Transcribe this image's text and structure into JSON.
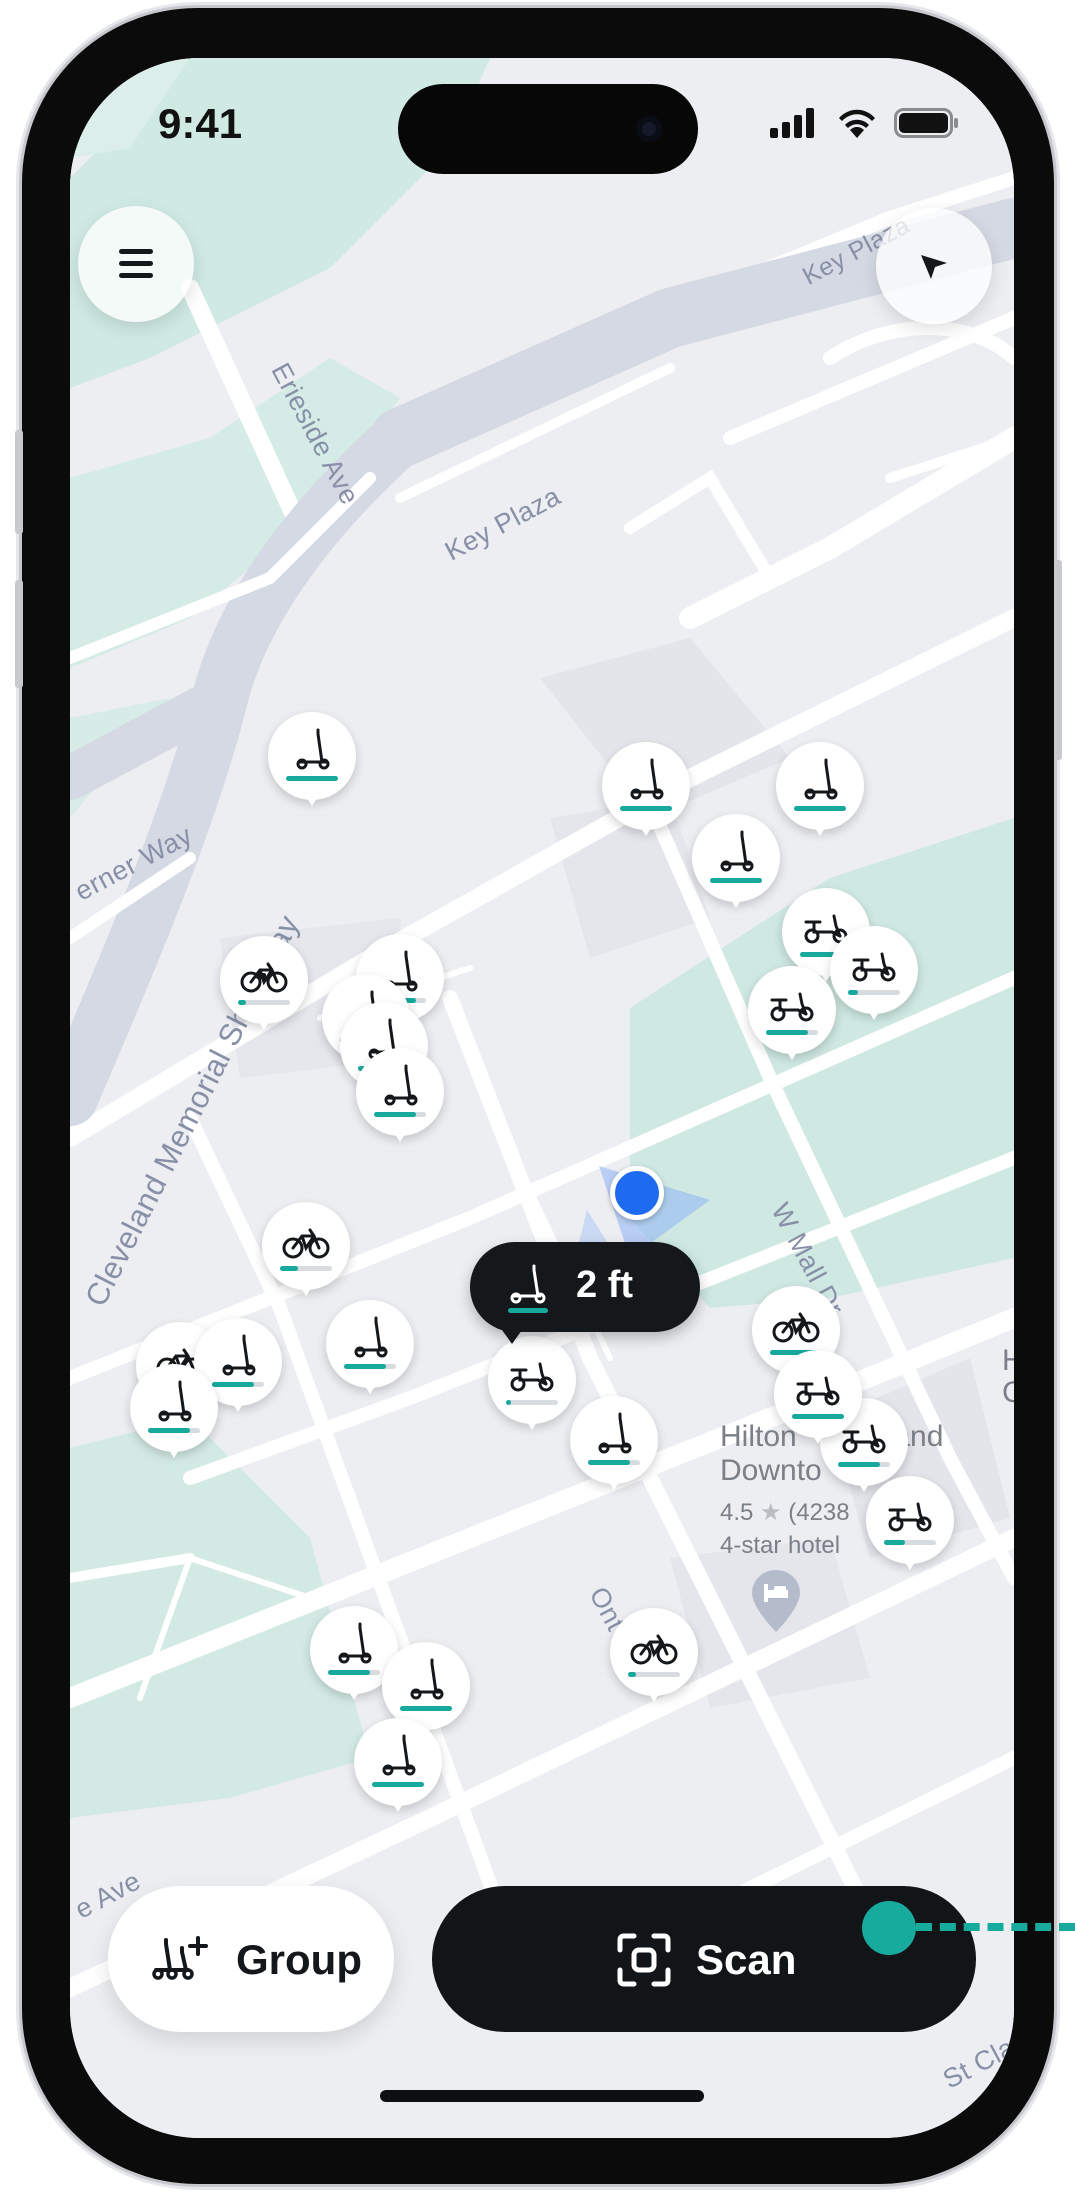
{
  "status_bar": {
    "time": "9:41"
  },
  "header": {
    "menu_icon": "hamburger-icon",
    "locate_icon": "navigation-arrow-icon"
  },
  "map": {
    "streets": [
      {
        "name": "Key Plaza"
      },
      {
        "name": "Key Plaza"
      },
      {
        "name": "Erieside Ave"
      },
      {
        "name": "Cleveland Memorial Shoreway"
      },
      {
        "name": "erner Way"
      },
      {
        "name": "W Mall Dr"
      },
      {
        "name": "Ont St"
      },
      {
        "name": "e Ave"
      },
      {
        "name": "St Cla"
      }
    ],
    "poi": {
      "name_line1": "Hilton",
      "name_line1b": "land",
      "name_line2": "Downto",
      "rating": "4.5",
      "reviews": "(4238",
      "category": "4-star hotel",
      "icon": "bed-icon"
    },
    "edge_letters": [
      "H",
      "C"
    ]
  },
  "vehicles": [
    {
      "type": "scooter",
      "battery": 1.0
    },
    {
      "type": "scooter",
      "battery": 1.0
    },
    {
      "type": "scooter",
      "battery": 1.0
    },
    {
      "type": "ebike",
      "battery": 0.15
    },
    {
      "type": "scooter",
      "battery": 1.0
    },
    {
      "type": "moped",
      "battery": 0.8
    },
    {
      "type": "moped",
      "battery": 0.2
    },
    {
      "type": "moped",
      "battery": 0.8
    },
    {
      "type": "scooter",
      "battery": 0.8
    },
    {
      "type": "scooter",
      "battery": 0.8
    },
    {
      "type": "scooter",
      "battery": 0.8
    },
    {
      "type": "scooter",
      "battery": 0.8
    },
    {
      "type": "bike",
      "battery": 0.35
    },
    {
      "type": "bike",
      "battery": 0.15
    },
    {
      "type": "scooter",
      "battery": 0.8
    },
    {
      "type": "scooter",
      "battery": 0.8
    },
    {
      "type": "scooter",
      "battery": 0.8
    },
    {
      "type": "moped",
      "battery": 0.1
    },
    {
      "type": "scooter",
      "battery": 0.8
    },
    {
      "type": "bike",
      "battery": 1.0
    },
    {
      "type": "moped",
      "battery": 0.8
    },
    {
      "type": "moped",
      "battery": 1.0
    },
    {
      "type": "moped",
      "battery": 0.4
    },
    {
      "type": "bike",
      "battery": 0.15
    },
    {
      "type": "scooter",
      "battery": 0.8
    },
    {
      "type": "scooter",
      "battery": 1.0
    },
    {
      "type": "scooter",
      "battery": 1.0
    }
  ],
  "nearest_vehicle": {
    "icon": "scooter-icon",
    "distance": "2 ft"
  },
  "actions": {
    "group_label": "Group",
    "group_icon": "group-scooters-icon",
    "scan_label": "Scan",
    "scan_icon": "scan-icon"
  },
  "colors": {
    "accent": "#17a99c",
    "map_bg": "#eceef1",
    "park": "#cfe8e2",
    "road_highway": "#d4d8e2",
    "user_location": "#1f6bf0",
    "dark_button": "#121517"
  }
}
